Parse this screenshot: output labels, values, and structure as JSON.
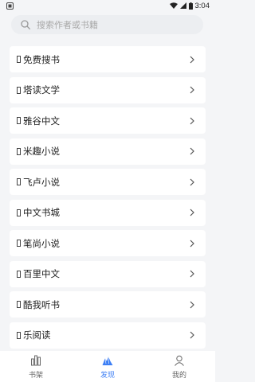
{
  "status_bar": {
    "time": "3:04"
  },
  "search": {
    "placeholder": "搜索作者或书籍"
  },
  "sources": [
    {
      "label": "免费搜书"
    },
    {
      "label": "塔读文学"
    },
    {
      "label": "雅谷中文"
    },
    {
      "label": "米趣小说"
    },
    {
      "label": "飞卢小说"
    },
    {
      "label": "中文书城"
    },
    {
      "label": "笔尚小说"
    },
    {
      "label": "百里中文"
    },
    {
      "label": "酷我听书"
    },
    {
      "label": "乐阅读"
    }
  ],
  "tabs": [
    {
      "label": "书架",
      "icon": "bookshelf-icon",
      "active": false
    },
    {
      "label": "发现",
      "icon": "discover-icon",
      "active": true
    },
    {
      "label": "我的",
      "icon": "profile-icon",
      "active": false
    }
  ],
  "colors": {
    "accent": "#3d7ff5",
    "background": "#f4f5f7",
    "card": "#ffffff"
  }
}
